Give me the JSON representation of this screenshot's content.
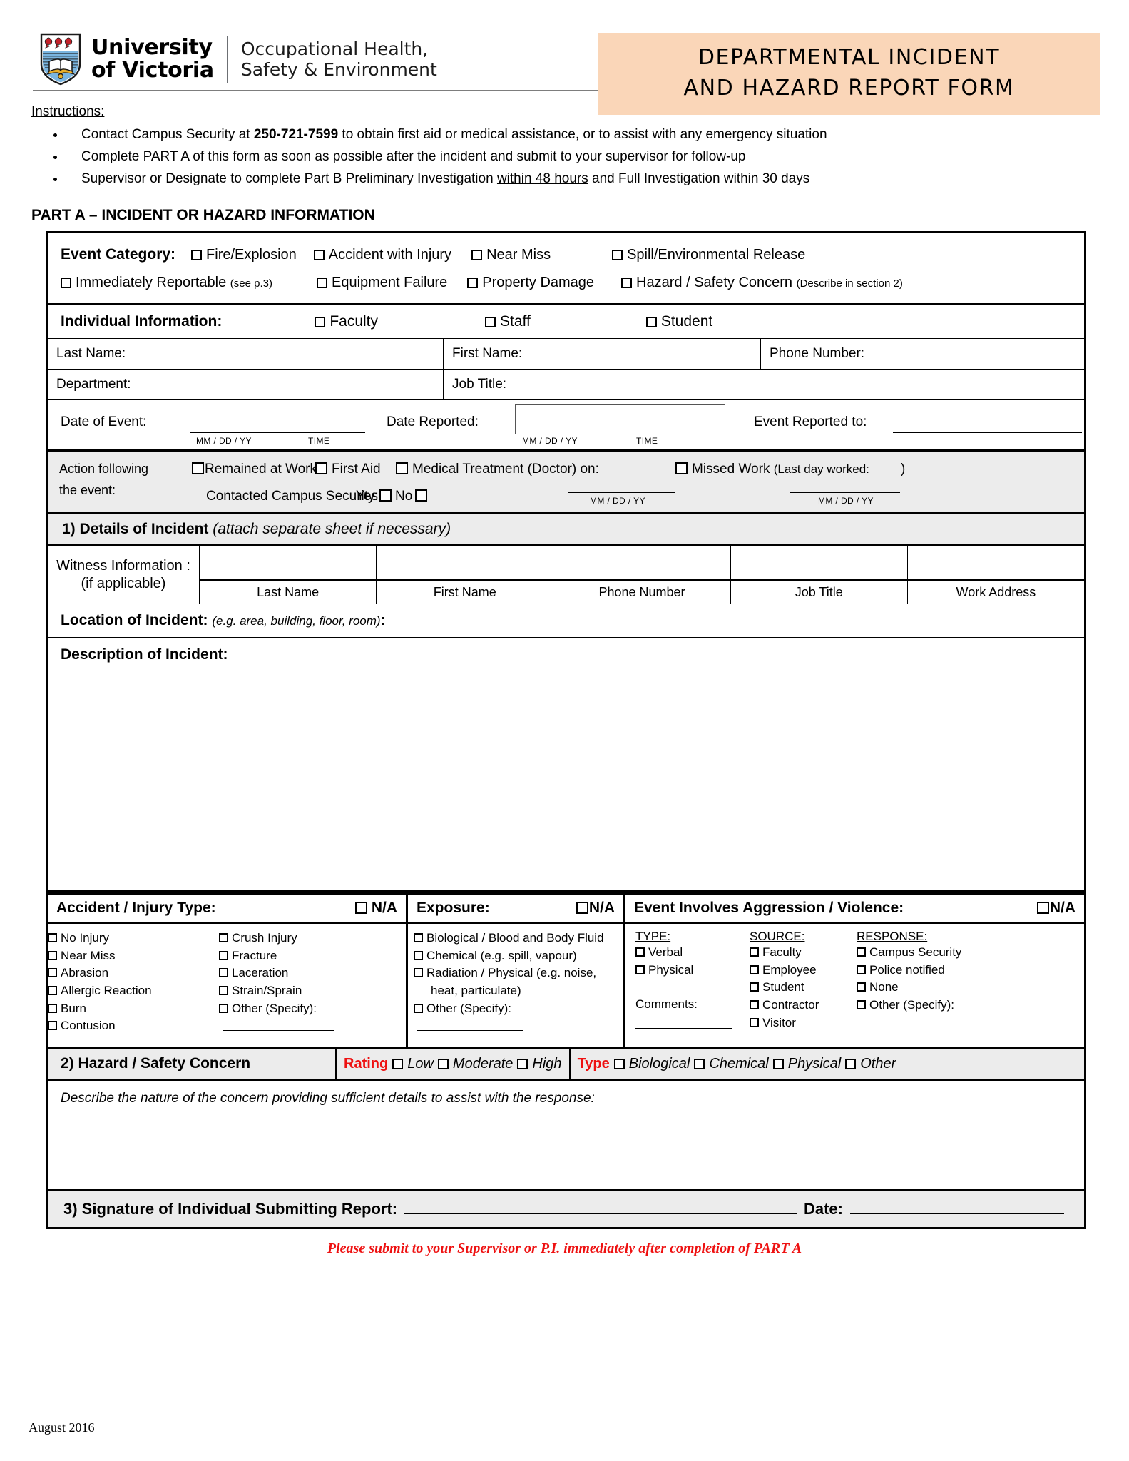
{
  "header": {
    "university_line1": "University",
    "university_line2": "of Victoria",
    "dept_line1": "Occupational Health,",
    "dept_line2": "Safety & Environment",
    "title_line1": "DEPARTMENTAL INCIDENT",
    "title_line2": "AND HAZARD REPORT FORM",
    "banner_color": "#fad6b8"
  },
  "instructions": {
    "heading": "Instructions:",
    "items": [
      {
        "pre": "Contact Campus Security at ",
        "bold": "250-721-7599",
        "post": " to obtain first aid or medical assistance, or to assist with any emergency situation"
      },
      {
        "pre": "Complete PART A of this form as soon as possible after the incident and submit to your supervisor for follow-up",
        "bold": "",
        "post": ""
      },
      {
        "pre": "Supervisor or Designate to complete Part B Preliminary Investigation ",
        "underline": "within 48 hours",
        "post": " and Full Investigation within 30 days"
      }
    ]
  },
  "part_a": {
    "heading": "PART A – INCIDENT OR HAZARD INFORMATION"
  },
  "event_category": {
    "label": "Event Category:",
    "row1": [
      "Fire/Explosion",
      "Accident with Injury",
      "Near Miss",
      "Spill/Environmental Release"
    ],
    "row2_immediately": "Immediately Reportable",
    "row2_immediately_note": "(see p.3)",
    "row2": [
      "Equipment Failure",
      "Property Damage"
    ],
    "row2_hazard": "Hazard / Safety Concern",
    "row2_hazard_note": "(Describe in section 2)"
  },
  "individual": {
    "label": "Individual Information:",
    "options": [
      "Faculty",
      "Staff",
      "Student"
    ],
    "last_name": "Last Name:",
    "first_name": "First Name:",
    "phone_number": "Phone Number:",
    "department": "Department:",
    "job_title": "Job Title:"
  },
  "dates": {
    "date_of_event": "Date of Event:",
    "date_reported": "Date Reported:",
    "event_reported_to": "Event Reported to:",
    "mmddyy": "MM / DD / YY",
    "time": "TIME"
  },
  "action": {
    "label_line1": "Action following",
    "label_line2": "the event:",
    "remained_at_work": "Remained at Work",
    "first_aid": "First Aid",
    "medical_treatment": "Medical Treatment (Doctor) on:",
    "contacted_security": "Contacted Campus Security:",
    "yes": "Yes",
    "no": "No",
    "missed_work": "Missed Work",
    "last_day_worked": "(Last day worked:",
    "close_paren": ")",
    "mmddyy": "MM / DD / YY"
  },
  "section1": {
    "number": "1)",
    "title": "Details of Incident",
    "note": "(attach separate sheet if necessary)",
    "witness_label_line1": "Witness Information :",
    "witness_label_line2": "(if applicable)",
    "witness_columns": [
      "Last Name",
      "First Name",
      "Phone Number",
      "Job Title",
      "Work Address"
    ],
    "location_label": "Location of Incident:",
    "location_eg": "(e.g. area, building, floor, room)",
    "location_colon": ":",
    "description_label": "Description of Incident:"
  },
  "injury": {
    "accident_heading": "Accident / Injury Type:",
    "accident_na": "N/A",
    "accident_col1": [
      "No Injury",
      "Near Miss",
      "Abrasion",
      "Allergic Reaction",
      "Burn",
      "Contusion"
    ],
    "accident_col2": [
      "Crush Injury",
      "Fracture",
      "Laceration",
      "Strain/Sprain",
      "Other (Specify):"
    ],
    "exposure_heading": "Exposure:",
    "exposure_na": "N/A",
    "exposure_items": [
      "Biological / Blood and Body Fluid",
      "Chemical (e.g. spill, vapour)",
      "Radiation / Physical (e.g. noise,",
      "Other (Specify):"
    ],
    "exposure_wrap": "heat, particulate)",
    "aggression_heading": "Event Involves Aggression / Violence:",
    "aggression_na": "N/A",
    "type_label": "TYPE:",
    "type_items": [
      "Verbal",
      "Physical"
    ],
    "comments_label": "Comments:",
    "source_label": "SOURCE:",
    "source_items": [
      "Faculty",
      "Employee",
      "Student",
      "Contractor",
      "Visitor"
    ],
    "response_label": "RESPONSE:",
    "response_items": [
      "Campus Security",
      "Police notified",
      "None",
      "Other (Specify):"
    ]
  },
  "section2": {
    "number": "2)",
    "title": "Hazard / Safety Concern",
    "rating_label": "Rating",
    "rating_options": [
      "Low",
      "Moderate",
      "High"
    ],
    "type_label": "Type",
    "type_options": [
      "Biological",
      "Chemical",
      "Physical",
      "Other"
    ],
    "describe": "Describe the nature of the concern providing sufficient details to assist with the response:",
    "red_color": "#ee1111"
  },
  "section3": {
    "label": "3) Signature of Individual Submitting Report:",
    "date_label": "Date:"
  },
  "footer": {
    "note": "Please submit to your Supervisor or P.I. immediately after completion of PART A",
    "date": "August 2016"
  }
}
